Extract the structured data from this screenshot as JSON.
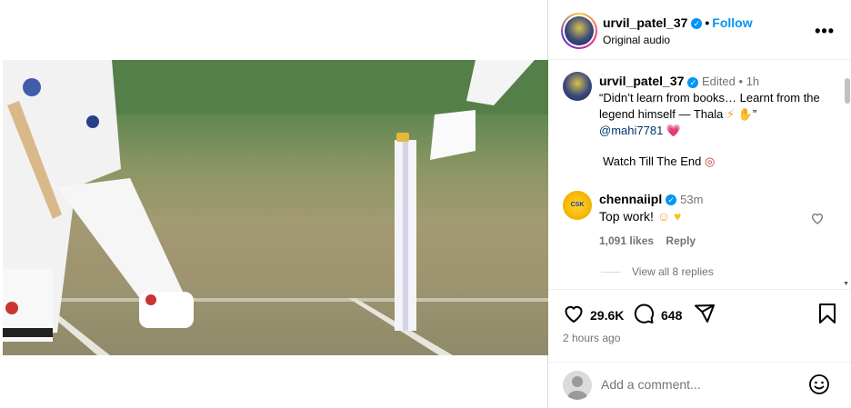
{
  "header": {
    "username": "urvil_patel_37",
    "separator": "•",
    "follow_label": "Follow",
    "audio": "Original audio",
    "more_label": "•••"
  },
  "caption": {
    "username": "urvil_patel_37",
    "edited": "Edited",
    "separator": "•",
    "time": "1h",
    "text": "“Didn’t learn from books… Learnt from the legend himself — Thala",
    "text_tail": "”",
    "mention": "@mahi7781",
    "line2": "Watch Till The End"
  },
  "comments": [
    {
      "username": "chennaiipl",
      "time": "53m",
      "text": "Top work!",
      "likes": "1,091 likes",
      "reply_label": "Reply",
      "view_replies": "View all 8 replies"
    }
  ],
  "actions": {
    "likes": "29.6K",
    "comments": "648",
    "posted": "2 hours ago"
  },
  "add_comment": {
    "placeholder": "Add a comment..."
  },
  "colors": {
    "accent": "#0095f6",
    "mention": "#00376b",
    "muted": "#737373"
  },
  "icons": [
    "verified-badge-icon",
    "heart-icon",
    "comment-icon",
    "share-icon",
    "bookmark-icon",
    "emoji-icon",
    "mute-icon",
    "more-options-icon"
  ]
}
